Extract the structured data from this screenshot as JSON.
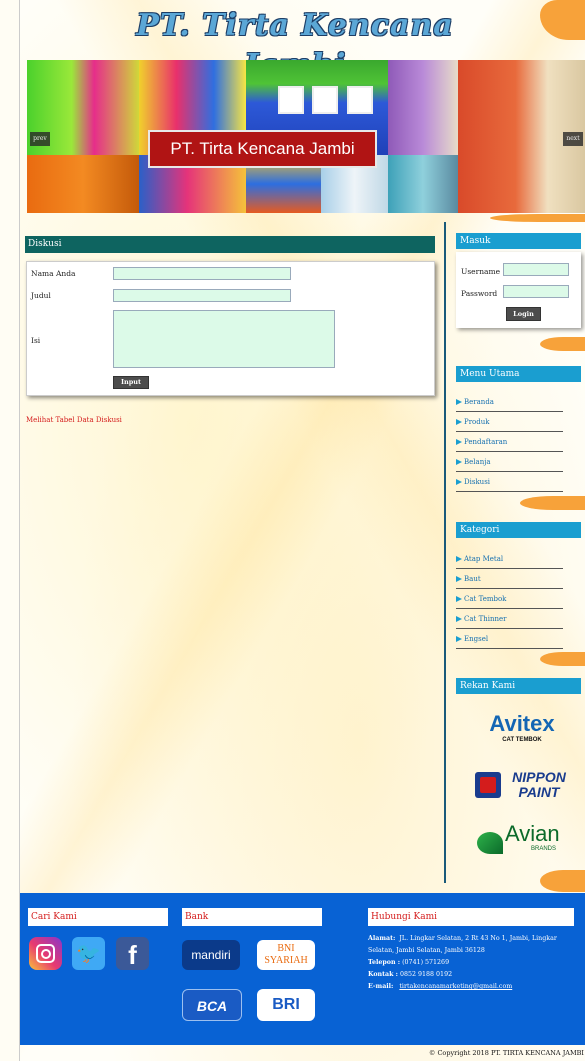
{
  "header": {
    "site_title": "PT. Tirta Kencana Jambi",
    "banner_caption": "PT. Tirta Kencana Jambi",
    "prev_label": "prev",
    "next_label": "next"
  },
  "discussion": {
    "title": "Diskusi",
    "name_label": "Nama Anda",
    "name_value": "",
    "subject_label": "Judul",
    "subject_value": "",
    "content_label": "Isi",
    "content_value": "",
    "submit_label": "Input",
    "view_link": "Melihat Tabel Data Diskusi"
  },
  "login": {
    "title": "Masuk",
    "username_label": "Username",
    "username_value": "",
    "password_label": "Password",
    "password_value": "",
    "button_label": "Login"
  },
  "main_menu": {
    "title": "Menu Utama",
    "items": [
      "Beranda",
      "Produk",
      "Pendaftaran",
      "Belanja",
      "Diskusi"
    ]
  },
  "categories": {
    "title": "Kategori",
    "items": [
      "Atap Metal",
      "Baut",
      "Cat Tembok",
      "Cat Thinner",
      "Engsel"
    ]
  },
  "partners": {
    "title": "Rekan Kami",
    "logos": [
      {
        "name": "Avitex",
        "sub": "CAT TEMBOK"
      },
      {
        "name": "NIPPON PAINT"
      },
      {
        "name": "Avian",
        "sub": "BRANDS"
      }
    ]
  },
  "footer": {
    "find_us_title": "Cari Kami",
    "social_icons": [
      "instagram-icon",
      "twitter-icon",
      "facebook-icon"
    ],
    "bank_title": "Bank",
    "banks": [
      "mandiri",
      "BNI SYARIAH",
      "BCA",
      "BRI"
    ],
    "contact_title": "Hubungi Kami",
    "address_label": "Alamat:",
    "address_value": "JL. Lingkar Selatan, 2 Rt 43 No 1, Jambi, Lingkar Selatan, Jambi Selatan, Jambi 36128",
    "phone_label": "Telepon :",
    "phone_value": "(0741) 571269",
    "contact_label": "Kontak :",
    "contact_value": "0852 9188 0192",
    "email_label": "E-mail:",
    "email_value": "tirtakencanamarketing@gmail.com",
    "copyright": "© Copyright 2018 PT. TIRTA KENCANA JAMBI"
  },
  "colors": {
    "accent_blue": "#1a9ed0",
    "title_teal": "#0e6460",
    "footer_blue": "#0862d4",
    "link_red": "#d41c1c",
    "input_green": "#dcfae8",
    "swoosh_orange": "#f7a23a"
  }
}
